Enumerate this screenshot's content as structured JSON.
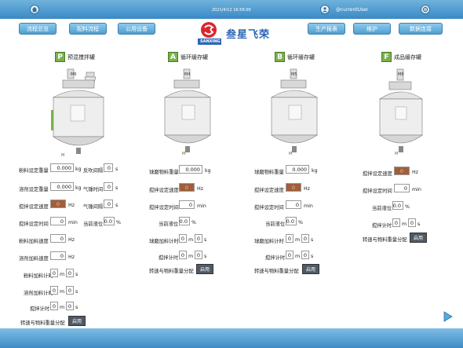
{
  "header": {
    "datetime": "2021/4/12 16:56:00",
    "user": "@currentUser"
  },
  "nav": {
    "left": [
      "流程总览",
      "配料流程",
      "公用设备"
    ],
    "right": [
      "生产报表",
      "维护",
      "数据连接"
    ]
  },
  "brand": {
    "name": "叁星飞荣",
    "logo_text": "SANXING"
  },
  "tanks": [
    {
      "letter": "P",
      "title": "预混搅拌罐",
      "motor": "M6",
      "bottom_motor": "M"
    },
    {
      "letter": "A",
      "title": "循环缓存罐",
      "motor": "M4",
      "bottom_motor": "M"
    },
    {
      "letter": "B",
      "title": "循环缓存罐",
      "motor": "M5",
      "bottom_motor": "M"
    },
    {
      "letter": "F",
      "title": "成品缓存罐",
      "motor": "M8",
      "bottom_motor": "M"
    }
  ],
  "p_panel": {
    "powder_weight": {
      "label": "粉料设定重量",
      "value": "0.000",
      "unit": "kg"
    },
    "reverse_interval": {
      "label": "反吹间隔",
      "value": "0",
      "unit": "s"
    },
    "solvent_weight": {
      "label": "溶剂设定重量",
      "value": "0.000",
      "unit": "kg"
    },
    "blow_time": {
      "label": "气锤时间",
      "value": "0",
      "unit": "s"
    },
    "stir_speed": {
      "label": "搅拌设定速度",
      "value": "0",
      "unit": "Hz"
    },
    "blow_interval": {
      "label": "气锤间隔",
      "value": "0",
      "unit": "s"
    },
    "stir_time": {
      "label": "搅拌设定时间",
      "value": "0",
      "unit": "min"
    },
    "level": {
      "label": "当前液位",
      "value": "0.0",
      "unit": "%"
    },
    "powder_speed": {
      "label": "粉料加料速度",
      "value": "0",
      "unit": "Hz"
    },
    "solvent_speed": {
      "label": "溶剂加料速度",
      "value": "0",
      "unit": "Hz"
    },
    "powder_timer": {
      "label": "粉料加料计时",
      "m": "0",
      "s": "0"
    },
    "solvent_timer": {
      "label": "溶剂加料计时",
      "m": "0",
      "s": "0"
    },
    "stir_timer": {
      "label": "搅拌计时",
      "m": "0",
      "s": "0"
    },
    "ratio": {
      "label": "转速与物料重量分配",
      "button": "启用"
    }
  },
  "a_panel": {
    "ball_weight": {
      "label": "球磨物料重量",
      "value": "0.000",
      "unit": "kg"
    },
    "stir_speed": {
      "label": "搅拌设定速度",
      "value": "0",
      "unit": "Hz"
    },
    "stir_time": {
      "label": "搅拌设定时间",
      "value": "0",
      "unit": "min"
    },
    "level": {
      "label": "当前液位",
      "value": "0.0",
      "unit": "%"
    },
    "feed_timer": {
      "label": "球磨加料计时",
      "m": "0",
      "s": "0"
    },
    "stir_timer": {
      "label": "搅拌计时",
      "m": "0",
      "s": "0"
    },
    "ratio": {
      "label": "转速与物料重量分配",
      "button": "启用"
    }
  },
  "b_panel": {
    "ball_weight": {
      "label": "球磨物料重量",
      "value": "0.000",
      "unit": "kg"
    },
    "stir_speed": {
      "label": "搅拌设定速度",
      "value": "0",
      "unit": "Hz"
    },
    "stir_time": {
      "label": "搅拌设定时间",
      "value": "0",
      "unit": "min"
    },
    "level": {
      "label": "当前液位",
      "value": "0.0",
      "unit": "%"
    },
    "feed_timer": {
      "label": "球磨加料计时",
      "m": "0",
      "s": "0"
    },
    "stir_timer": {
      "label": "搅拌计时",
      "m": "0",
      "s": "0"
    },
    "ratio": {
      "label": "转速与物料重量分配",
      "button": "启用"
    }
  },
  "f_panel": {
    "stir_speed": {
      "label": "搅拌设定速度",
      "value": "0",
      "unit": "Hz"
    },
    "stir_time": {
      "label": "搅拌设定时间",
      "value": "0",
      "unit": "min"
    },
    "level": {
      "label": "当前液位",
      "value": "0.0",
      "unit": "%"
    },
    "stir_timer": {
      "label": "搅拌计时",
      "m": "0",
      "s": "0"
    },
    "ratio": {
      "label": "转速与物料重量分配",
      "button": "启用"
    }
  },
  "labels": {
    "m": "m",
    "s": "s"
  }
}
